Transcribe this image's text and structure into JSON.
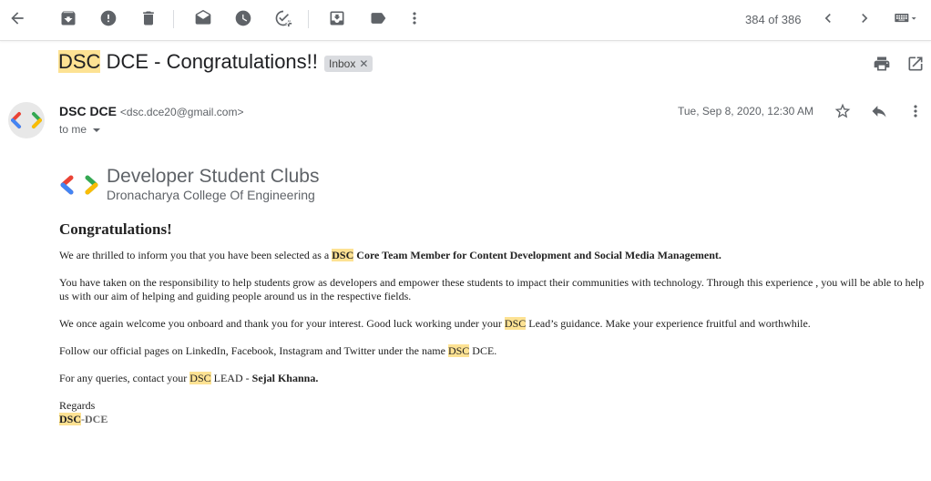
{
  "toolbar": {
    "pager_text": "384 of 386"
  },
  "subject": {
    "hl": "DSC",
    "rest": " DCE - Congratulations!!",
    "label": "Inbox"
  },
  "sender": {
    "name": "DSC DCE",
    "email": "<dsc.dce20@gmail.com>",
    "to": "to me",
    "date": "Tue, Sep 8, 2020, 12:30 AM"
  },
  "body": {
    "logo_title": "Developer Student Clubs",
    "logo_sub": "Dronacharya College Of Engineering",
    "heading": "Congratulations!",
    "p1_pre": "We are thrilled to inform you that you have been selected as a ",
    "p1_hl": "DSC",
    "p1_bold": " Core Team Member for Content Development and Social Media Management.",
    "p2": "You have taken on the responsibility to help students grow as developers and empower these students to impact their communities with technology. Through this experience , you will be able to help us with our aim of helping and guiding people around us in the respective fields.",
    "p3_pre": "We once again welcome you onboard and thank you for your interest. Good luck working under your ",
    "p3_hl": "DSC",
    "p3_post": " Lead’s guidance. Make your experience fruitful and worthwhile.",
    "p4_pre": "Follow our official pages on LinkedIn, Facebook, Instagram and Twitter under the name ",
    "p4_hl": "DSC",
    "p4_post": " DCE.",
    "p5_pre": "For any queries, contact your ",
    "p5_hl": "DSC",
    "p5_mid": " LEAD - ",
    "p5_bold": "Sejal Khanna.",
    "regards": "Regards",
    "sig_hl": "DSC",
    "sig_post": "-DCE"
  }
}
